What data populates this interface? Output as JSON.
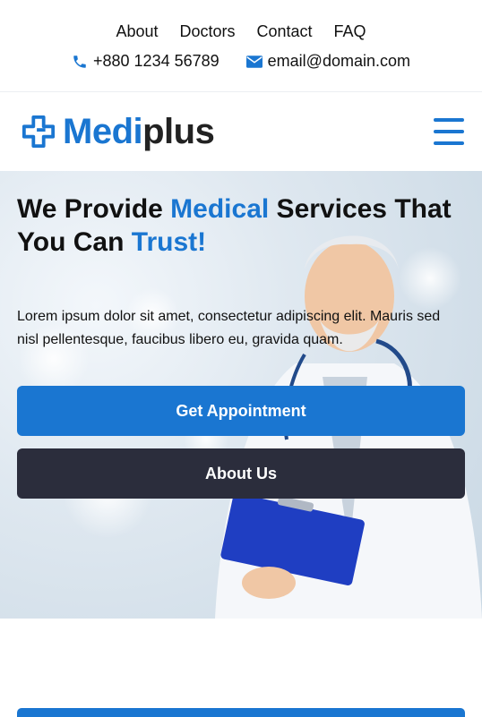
{
  "top_nav": {
    "links": [
      "About",
      "Doctors",
      "Contact",
      "FAQ"
    ]
  },
  "contact": {
    "phone": "+880 1234 56789",
    "email": "email@domain.com",
    "phone_icon": "phone-icon",
    "email_icon": "envelope-icon"
  },
  "brand": {
    "logo_part1": "Medi",
    "logo_part2": "plus",
    "logo_icon": "medical-cross-icon"
  },
  "hero": {
    "title_1": "We Provide ",
    "title_highlight_1": "Medical",
    "title_2": " Services That You Can ",
    "title_highlight_2": "Trust!",
    "description": "Lorem ipsum dolor sit amet, consectetur adipiscing elit. Mauris sed nisl pellentesque, faucibus libero eu, gravida quam.",
    "primary_button": "Get Appointment",
    "secondary_button": "About Us"
  },
  "colors": {
    "accent": "#1a76d1",
    "dark_button": "#2b2d3c"
  }
}
